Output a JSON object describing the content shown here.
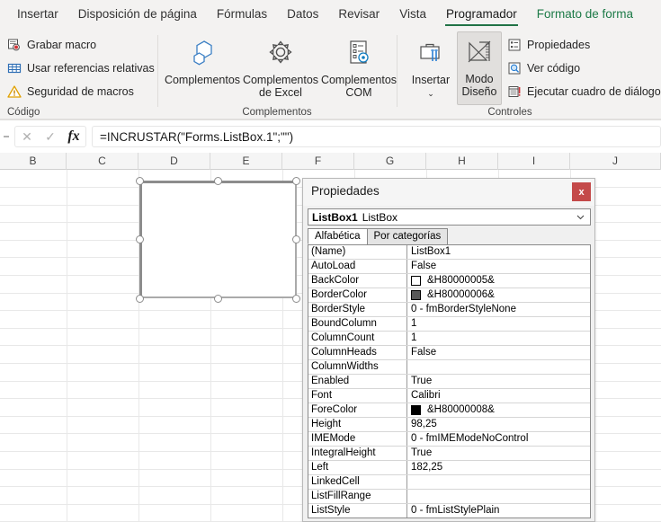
{
  "ribbon": {
    "tabs": [
      {
        "label": "Insertar",
        "state": "normal"
      },
      {
        "label": "Disposición de página",
        "state": "normal"
      },
      {
        "label": "Fórmulas",
        "state": "normal"
      },
      {
        "label": "Datos",
        "state": "normal"
      },
      {
        "label": "Revisar",
        "state": "normal"
      },
      {
        "label": "Vista",
        "state": "normal"
      },
      {
        "label": "Programador",
        "state": "active"
      },
      {
        "label": "Formato de forma",
        "state": "contextual"
      }
    ],
    "groups": [
      {
        "name": "Código",
        "label": "Código"
      },
      {
        "name": "Complementos",
        "label": "Complementos"
      },
      {
        "name": "Controles",
        "label": "Controles"
      }
    ],
    "code_group": {
      "record_macro": "Grabar macro",
      "relative_refs": "Usar referencias relativas",
      "macro_security": "Seguridad de macros",
      "icons": [
        "record-macro-icon",
        "relative-references-icon",
        "macro-security-warning-icon"
      ]
    },
    "addins_group": {
      "addins": "Complementos",
      "excel_addins_line1": "Complementos",
      "excel_addins_line2": "de Excel",
      "com_addins_line1": "Complementos",
      "com_addins_line2": "COM",
      "icons": [
        "addins-hexagon-icon",
        "excel-addins-gear-icon",
        "com-addins-icon"
      ]
    },
    "controls_group": {
      "insert": "Insertar",
      "design_mode_line1": "Modo",
      "design_mode_line2": "Diseño",
      "properties": "Propiedades",
      "view_code": "Ver código",
      "run_dialog": "Ejecutar cuadro de diálogo",
      "icons": [
        "insert-control-icon",
        "design-mode-icon",
        "properties-icon",
        "view-code-icon",
        "run-dialog-icon"
      ]
    }
  },
  "formula_bar": {
    "cancel_icon": "close-icon",
    "enter_icon": "check-icon",
    "function_icon": "fx-icon",
    "value": "=INCRUSTAR(\"Forms.ListBox.1\";\"\")",
    "placeholder": ""
  },
  "grid": {
    "column_headers": [
      "B",
      "C",
      "D",
      "E",
      "F",
      "G",
      "H",
      "I",
      "J"
    ]
  },
  "shape": {
    "name": "listbox-control-shape",
    "selected": true,
    "handle_count": 8
  },
  "properties_window": {
    "title": "Propiedades",
    "close_label": "x",
    "close_color": "#c44a4a",
    "object_name": "ListBox1",
    "object_type": "ListBox",
    "dropdown_icon": "chevron-down-icon",
    "tabs": [
      {
        "label": "Alfabética",
        "active": true
      },
      {
        "label": "Por categorías",
        "active": false
      }
    ],
    "rows": [
      {
        "name": "(Name)",
        "value": "ListBox1",
        "swatch": null
      },
      {
        "name": "AutoLoad",
        "value": "False",
        "swatch": null
      },
      {
        "name": "BackColor",
        "value": "&H80000005&",
        "swatch": "#ffffff"
      },
      {
        "name": "BorderColor",
        "value": "&H80000006&",
        "swatch": "#595959"
      },
      {
        "name": "BorderStyle",
        "value": "0 - fmBorderStyleNone",
        "swatch": null
      },
      {
        "name": "BoundColumn",
        "value": "1",
        "swatch": null
      },
      {
        "name": "ColumnCount",
        "value": "1",
        "swatch": null
      },
      {
        "name": "ColumnHeads",
        "value": "False",
        "swatch": null
      },
      {
        "name": "ColumnWidths",
        "value": "",
        "swatch": null
      },
      {
        "name": "Enabled",
        "value": "True",
        "swatch": null
      },
      {
        "name": "Font",
        "value": "Calibri",
        "swatch": null
      },
      {
        "name": "ForeColor",
        "value": "&H80000008&",
        "swatch": "#000000"
      },
      {
        "name": "Height",
        "value": "98,25",
        "swatch": null
      },
      {
        "name": "IMEMode",
        "value": "0 - fmIMEModeNoControl",
        "swatch": null
      },
      {
        "name": "IntegralHeight",
        "value": "True",
        "swatch": null
      },
      {
        "name": "Left",
        "value": "182,25",
        "swatch": null
      },
      {
        "name": "LinkedCell",
        "value": "",
        "swatch": null
      },
      {
        "name": "ListFillRange",
        "value": "",
        "swatch": null
      },
      {
        "name": "ListStyle",
        "value": "0 - fmListStylePlain",
        "swatch": null
      }
    ]
  }
}
